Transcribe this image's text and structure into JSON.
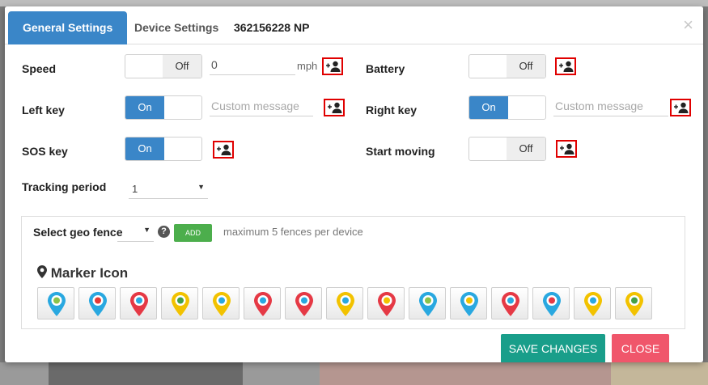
{
  "tabs": [
    {
      "label": "General Settings",
      "active": true
    },
    {
      "label": "Device Settings",
      "active": false
    }
  ],
  "device_id": "362156228 NP",
  "close_icon": "×",
  "rows": {
    "speed": {
      "label": "Speed",
      "toggle_on": "",
      "toggle_off": "Off",
      "state": "off",
      "value": "0",
      "unit": "mph"
    },
    "battery": {
      "label": "Battery",
      "toggle_on": "",
      "toggle_off": "Off",
      "state": "off"
    },
    "left_key": {
      "label": "Left key",
      "toggle_on": "On",
      "toggle_off": "",
      "state": "on",
      "placeholder": "Custom message"
    },
    "right_key": {
      "label": "Right key",
      "toggle_on": "On",
      "toggle_off": "",
      "state": "on",
      "placeholder": "Custom message"
    },
    "sos_key": {
      "label": "SOS key",
      "toggle_on": "On",
      "toggle_off": "",
      "state": "on"
    },
    "start_moving": {
      "label": "Start moving",
      "toggle_on": "",
      "toggle_off": "Off",
      "state": "off"
    },
    "tracking_period": {
      "label": "Tracking period",
      "value": "1"
    }
  },
  "geofence": {
    "label": "Select geo fence",
    "value": "",
    "help": "?",
    "add_label": "ADD",
    "hint": "maximum 5 fences per device"
  },
  "marker": {
    "title": "Marker Icon",
    "icons": [
      {
        "name": "marker-globe-icon",
        "color": "#29a8e0",
        "inner": "#8bc34a"
      },
      {
        "name": "marker-minus-icon",
        "color": "#29a8e0",
        "inner": "#e53935"
      },
      {
        "name": "marker-cloud-icon",
        "color": "#e53945",
        "inner": "#29a8e0"
      },
      {
        "name": "marker-target-icon",
        "color": "#f2c200",
        "inner": "#43a047"
      },
      {
        "name": "marker-eye-icon",
        "color": "#f2c200",
        "inner": "#29a8e0"
      },
      {
        "name": "marker-heart-icon",
        "color": "#e53945",
        "inner": "#29a8e0"
      },
      {
        "name": "marker-mustache-icon",
        "color": "#e53945",
        "inner": "#29a8e0"
      },
      {
        "name": "marker-key-icon",
        "color": "#f2c200",
        "inner": "#29a8e0"
      },
      {
        "name": "marker-sun-icon",
        "color": "#e53945",
        "inner": "#f2c200"
      },
      {
        "name": "marker-paw-icon",
        "color": "#29a8e0",
        "inner": "#8bc34a"
      },
      {
        "name": "marker-pencil-icon",
        "color": "#29a8e0",
        "inner": "#f2c200"
      },
      {
        "name": "marker-pin-icon",
        "color": "#e53945",
        "inner": "#29a8e0"
      },
      {
        "name": "marker-star-icon",
        "color": "#29a8e0",
        "inner": "#e53945"
      },
      {
        "name": "marker-walker-icon",
        "color": "#f2c200",
        "inner": "#29a8e0"
      },
      {
        "name": "marker-message-icon",
        "color": "#f2c200",
        "inner": "#43a047"
      }
    ]
  },
  "footer": {
    "save_label": "SAVE CHANGES",
    "close_label": "CLOSE"
  },
  "colors": {
    "tab_active": "#3a86c8",
    "toggle_on": "#3a86c8",
    "save": "#199e8a",
    "close": "#f0566b",
    "add": "#4cae4c",
    "highlight": "#e00000"
  }
}
